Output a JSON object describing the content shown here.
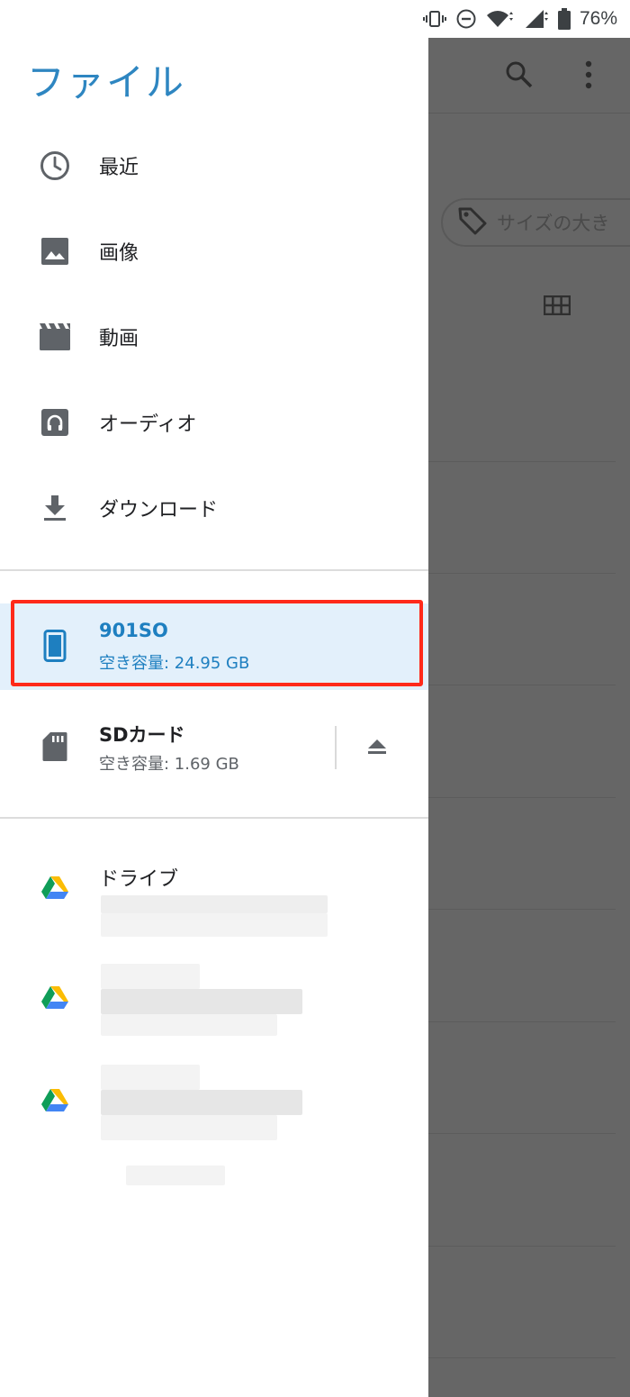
{
  "status_bar": {
    "battery_percent": "76%",
    "icons": [
      "vibrate-icon",
      "do-not-disturb-icon",
      "wifi-icon",
      "signal-icon",
      "battery-icon"
    ]
  },
  "drawer": {
    "title": "ファイル",
    "nav_items": [
      {
        "label": "最近",
        "icon": "clock-icon"
      },
      {
        "label": "画像",
        "icon": "image-icon"
      },
      {
        "label": "動画",
        "icon": "video-icon"
      },
      {
        "label": "オーディオ",
        "icon": "audio-icon"
      },
      {
        "label": "ダウンロード",
        "icon": "download-icon"
      }
    ],
    "storage": [
      {
        "name": "901SO",
        "free": "空き容量: 24.95 GB",
        "icon": "phone-icon",
        "selected": true
      },
      {
        "name": "SDカード",
        "free": "空き容量: 1.69 GB",
        "icon": "sd-card-icon",
        "eject_icon": "eject-icon"
      }
    ],
    "drives": [
      {
        "label": "ドライブ",
        "icon": "google-drive-icon"
      },
      {
        "label": "",
        "icon": "google-drive-icon"
      },
      {
        "label": "",
        "icon": "google-drive-icon"
      }
    ]
  },
  "background_app": {
    "chip_label": "サイズの大き",
    "icons": [
      "search-icon",
      "more-vert-icon",
      "tag-icon",
      "grid-view-icon"
    ]
  },
  "colors": {
    "accent": "#2e86c1",
    "selected_bg": "#e3f0fb",
    "highlight_border": "#ff2a1a",
    "scrim": "#666666"
  }
}
